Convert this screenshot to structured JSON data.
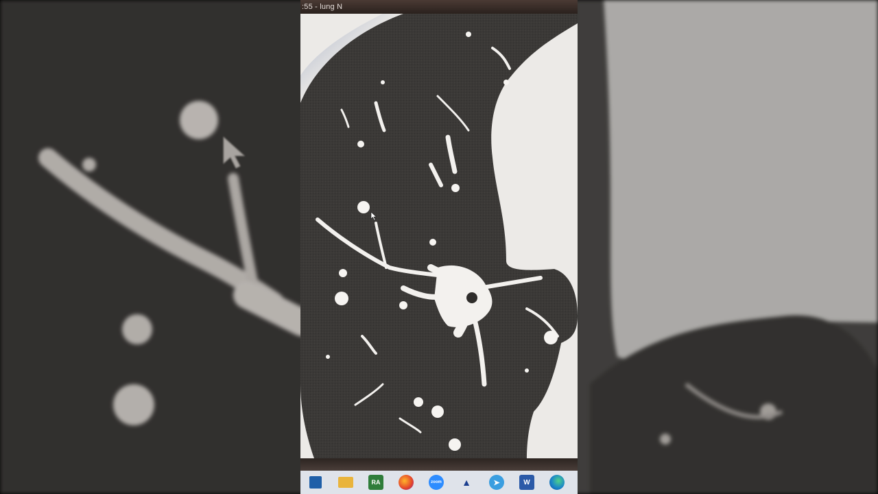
{
  "window": {
    "title": ":55 - lung N"
  },
  "taskbar": {
    "items": [
      {
        "name": "start-icon",
        "label": ""
      },
      {
        "name": "file-explorer-icon",
        "label": ""
      },
      {
        "name": "ra-app-icon",
        "label": "RA"
      },
      {
        "name": "firefox-icon",
        "label": ""
      },
      {
        "name": "zoom-icon",
        "label": "zoom"
      },
      {
        "name": "app-pin-icon",
        "label": ""
      },
      {
        "name": "telegram-icon",
        "label": ""
      },
      {
        "name": "word-icon",
        "label": "W"
      },
      {
        "name": "edge-icon",
        "label": ""
      }
    ]
  },
  "colors": {
    "background": "#000000",
    "lung_parenchyma": "#3a3836",
    "soft_tissue": "#eceae7",
    "taskbar": "#dfe3ea",
    "title_bar": "#2a211d"
  }
}
